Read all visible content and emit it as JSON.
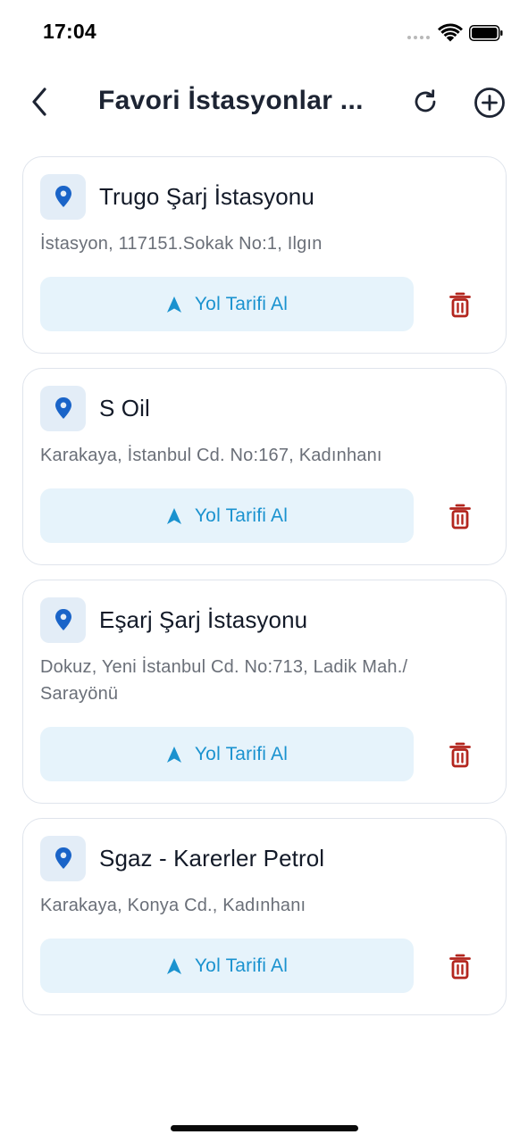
{
  "status_bar": {
    "time": "17:04"
  },
  "header": {
    "title": "Favori İstasyonlar ...",
    "back_icon": "chevron-left-icon",
    "refresh_icon": "refresh-icon",
    "add_icon": "plus-circle-icon"
  },
  "colors": {
    "accent": "#1a92cf",
    "pin": "#1a64c8",
    "pin_bg": "#e3edf7",
    "button_bg": "#e6f3fb",
    "delete": "#b3261e",
    "card_border": "#dfe4ec"
  },
  "stations": [
    {
      "name": "Trugo Şarj İstasyonu",
      "address": "İstasyon, 117151.Sokak No:1, Ilgın",
      "directions_label": "Yol Tarifi Al"
    },
    {
      "name": "S Oil",
      "address": "Karakaya, İstanbul Cd. No:167, Kadınhanı",
      "directions_label": "Yol Tarifi Al"
    },
    {
      "name": "Eşarj Şarj İstasyonu",
      "address": "Dokuz, Yeni İstanbul Cd. No:713, Ladik Mah./ Sarayönü",
      "directions_label": "Yol Tarifi Al"
    },
    {
      "name": "Sgaz - Karerler Petrol",
      "address": "Karakaya, Konya Cd., Kadınhanı",
      "directions_label": "Yol Tarifi Al"
    }
  ]
}
